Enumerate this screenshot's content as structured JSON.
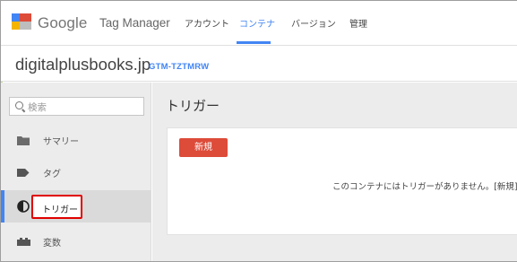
{
  "app": {
    "brand": "Google",
    "product": "Tag Manager"
  },
  "nav": {
    "items": [
      {
        "label": "アカウント",
        "active": false
      },
      {
        "label": "コンテナ",
        "active": true
      },
      {
        "label": "バージョン",
        "active": false
      },
      {
        "label": "管理",
        "active": false
      }
    ]
  },
  "container": {
    "name": "digitalplusbooks.jp",
    "id": "GTM-TZTMRW"
  },
  "sidebar": {
    "search_placeholder": "検索",
    "items": [
      {
        "label": "サマリー",
        "icon": "folder-icon",
        "active": false
      },
      {
        "label": "タグ",
        "icon": "tag-icon",
        "active": false
      },
      {
        "label": "トリガー",
        "icon": "trigger-icon",
        "active": true
      },
      {
        "label": "変数",
        "icon": "variables-icon",
        "active": false
      }
    ]
  },
  "main": {
    "title": "トリガー",
    "new_button": "新規",
    "empty_message": "このコンテナにはトリガーがありません。[新規] を"
  },
  "colors": {
    "accent": "#4285f4",
    "new_button": "#dd4b39",
    "highlight": "#e00000"
  }
}
